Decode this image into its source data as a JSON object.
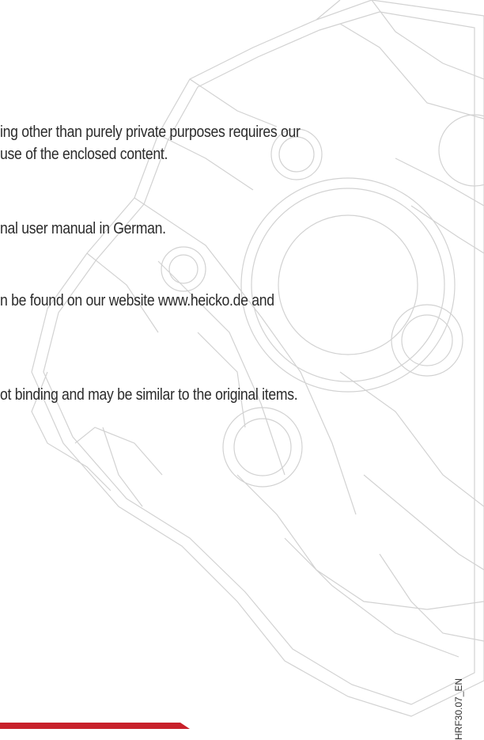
{
  "text_lines": [
    "ing other than purely private purposes requires our",
    " use of the enclosed content.",
    "nal user manual in German.",
    "n be found on our website www.heicko.de and",
    "ot binding and may be similar to the original items."
  ],
  "doc_code": "HRF30.07_EN",
  "colors": {
    "text": "#2b2b2b",
    "drawing_stroke": "#d0d0d0",
    "accent_bar": "#c8202a"
  }
}
